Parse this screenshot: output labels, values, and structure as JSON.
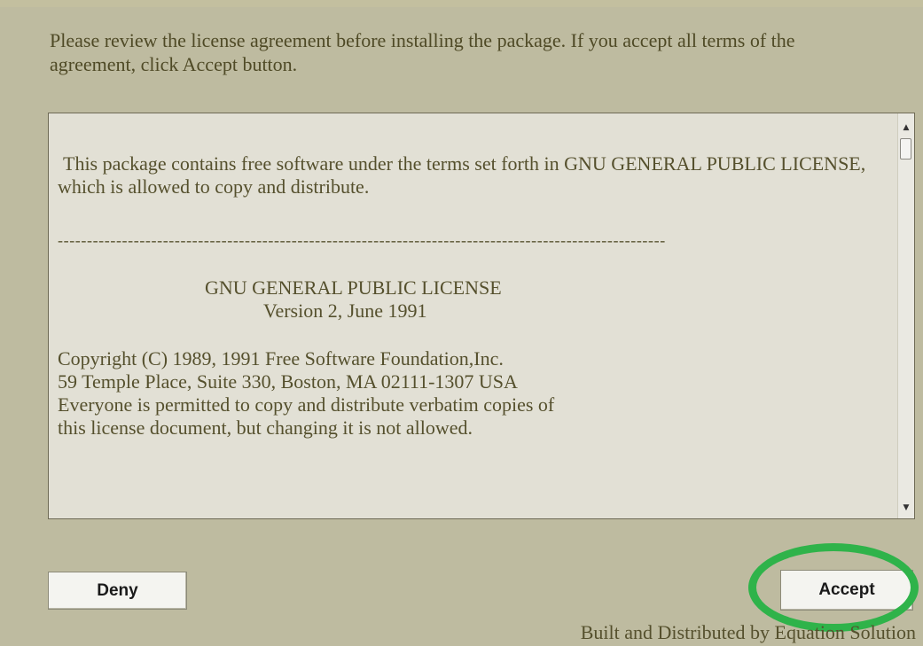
{
  "header": {
    "instructions": "Please review the license agreement before installing the package. If you accept all terms of the agreement, click Accept button."
  },
  "license": {
    "intro": "This package contains free software under the terms set forth in GNU GENERAL PUBLIC LICENSE, which is allowed to copy and distribute.",
    "separator": "--------------------------------------------------------------------------------------------------------",
    "title": "GNU GENERAL PUBLIC LICENSE",
    "version": "Version 2, June 1991",
    "copyright_lines": [
      "Copyright (C) 1989, 1991 Free Software Foundation,Inc.",
      "59 Temple Place, Suite 330, Boston, MA  02111-1307 USA",
      "Everyone is permitted to copy and distribute verbatim copies of",
      "this license document, but changing it is not allowed."
    ]
  },
  "scrollbar": {
    "up_arrow": "▲",
    "down_arrow": "▼"
  },
  "buttons": {
    "deny_label": "Deny",
    "accept_label": "Accept"
  },
  "footer": {
    "credit": "Built and Distributed by Equation Solution"
  },
  "colors": {
    "dialog_background": "#bebba0",
    "text_box_background": "#e2e0d5",
    "text_color": "#55502d",
    "highlight_ring": "#2fb34a"
  }
}
